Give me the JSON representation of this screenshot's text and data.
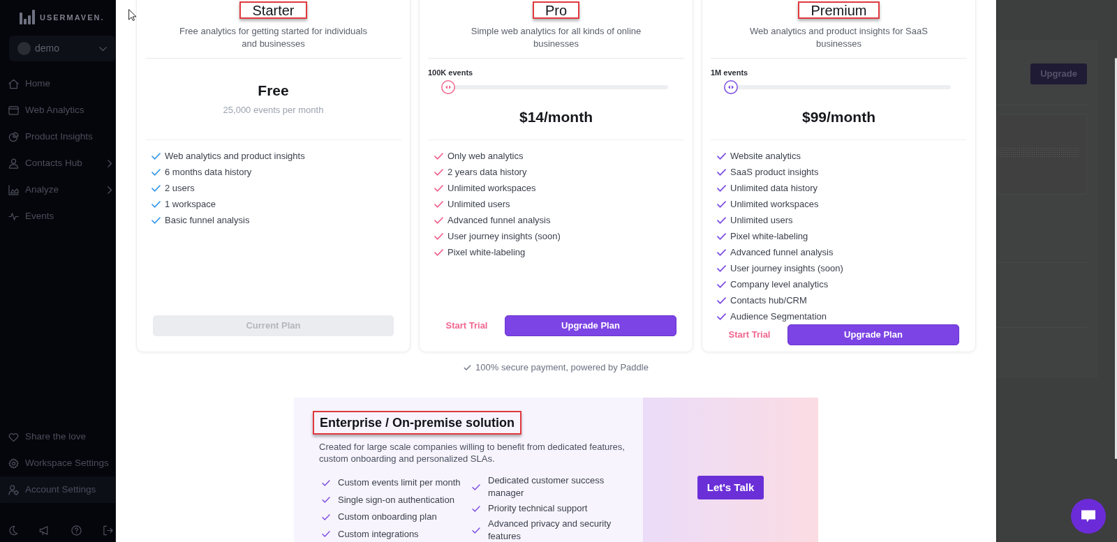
{
  "sidebar": {
    "logo": "USERMAVEN.",
    "workspace": "demo",
    "nav": [
      {
        "label": "Home",
        "submenu": false,
        "selected": false
      },
      {
        "label": "Web Analytics",
        "submenu": false,
        "selected": false
      },
      {
        "label": "Product Insights",
        "submenu": false,
        "selected": false
      },
      {
        "label": "Contacts Hub",
        "submenu": true,
        "selected": false
      },
      {
        "label": "Analyze",
        "submenu": true,
        "selected": false
      },
      {
        "label": "Events",
        "submenu": false,
        "selected": false
      }
    ],
    "footer_nav": [
      {
        "label": "Share the love",
        "selected": false
      },
      {
        "label": "Workspace Settings",
        "selected": false
      },
      {
        "label": "Account Settings",
        "selected": true
      }
    ]
  },
  "plans": [
    {
      "name": "Starter",
      "marked": true,
      "description": "Free analytics for getting started for individuals and businesses",
      "color": "#3d9be9",
      "price": "Free",
      "price_note": "25,000 events per month",
      "features": [
        "Web analytics and product insights",
        "6 months data history",
        "2 users",
        "1 workspace",
        "Basic funnel analysis"
      ],
      "buttons": [
        {
          "label": "Current Plan",
          "kind": "solid",
          "disabled": true
        }
      ]
    },
    {
      "name": "Pro",
      "marked": true,
      "description": "Simple web analytics for all kinds of online businesses",
      "color": "#f0668f",
      "events": {
        "label": "100K events",
        "level": 0
      },
      "price": "$14/month",
      "features": [
        "Only web analytics",
        "2 years data history",
        "Unlimited workspaces",
        "Unlimited users",
        "Advanced funnel analysis",
        "User journey insights (soon)",
        "Pixel white-labeling"
      ],
      "buttons": [
        {
          "label": "Start Trial",
          "kind": "text",
          "disabled": false
        },
        {
          "label": "Upgrade Plan",
          "kind": "solid",
          "disabled": false
        }
      ]
    },
    {
      "name": "Premium",
      "marked": true,
      "description": "Web analytics and product insights for SaaS businesses",
      "color": "#7b4ae2",
      "events": {
        "label": "1M events",
        "level": 0
      },
      "price": "$99/month",
      "features": [
        "Website analytics",
        "SaaS product insights",
        "Unlimited data history",
        "Unlimited workspaces",
        "Unlimited users",
        "Pixel white-labeling",
        "Advanced funnel analysis",
        "User journey insights (soon)",
        "Company level analytics",
        "Contacts hub/CRM",
        "Audience Segmentation"
      ],
      "buttons": [
        {
          "label": "Start Trial",
          "kind": "text",
          "disabled": false
        },
        {
          "label": "Upgrade Plan",
          "kind": "solid",
          "disabled": false
        }
      ]
    }
  ],
  "payment_note": "100% secure payment, powered by Paddle",
  "enterprise": {
    "title": "Enterprise / On-premise solution",
    "marked": true,
    "description": "Created for large scale companies willing to benefit from dedicated features, custom onboarding and personalized SLAs.",
    "feature_columns": [
      [
        "Custom events limit per month",
        "Single sign-on authentication",
        "Custom onboarding plan",
        "Custom integrations"
      ],
      [
        "Dedicated customer success manager",
        "Priority technical support",
        "Advanced privacy and security features"
      ]
    ],
    "button": "Let's Talk"
  },
  "background_page": {
    "upgrade_button": "Upgrade"
  }
}
